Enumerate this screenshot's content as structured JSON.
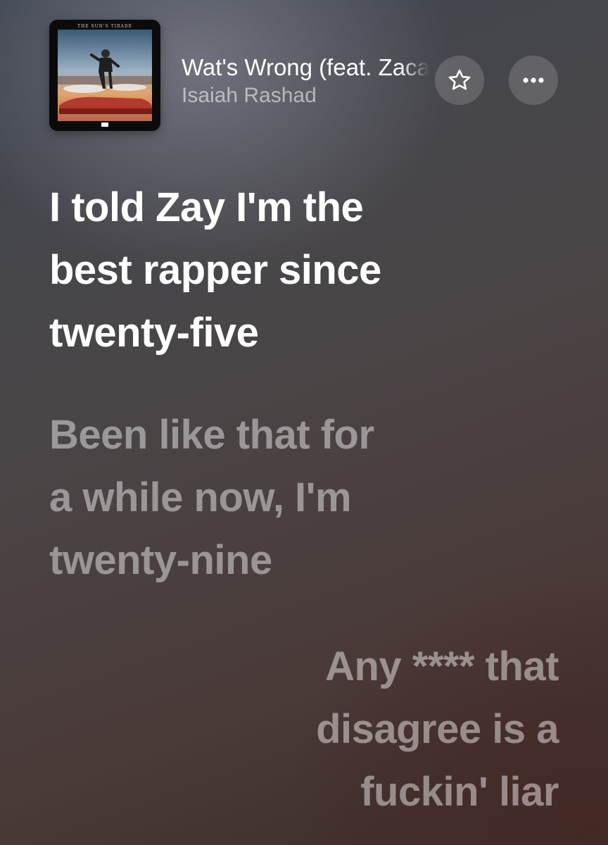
{
  "now_playing": {
    "artwork": {
      "alt_caption": "THE SUN'S TIRADE"
    },
    "title": "Wat's Wrong (feat. Zacari & Kendrick Lamar)",
    "artist": "Isaiah Rashad",
    "favorite_icon": "star-outline-icon",
    "more_icon": "ellipsis-icon"
  },
  "lyrics": [
    {
      "state": "active",
      "lines": [
        "I told Zay I'm the",
        "best rapper since",
        "twenty-five"
      ]
    },
    {
      "state": "inactive",
      "lines": [
        "Been like that for",
        "a while now, I'm",
        "twenty-nine"
      ]
    },
    {
      "state": "inactive",
      "lines": [
        "Any **** that",
        "disagree is a",
        "fuckin' liar"
      ]
    }
  ],
  "colors": {
    "active_lyric": "#ffffff",
    "inactive_lyric": "rgba(255,255,255,0.45)"
  }
}
